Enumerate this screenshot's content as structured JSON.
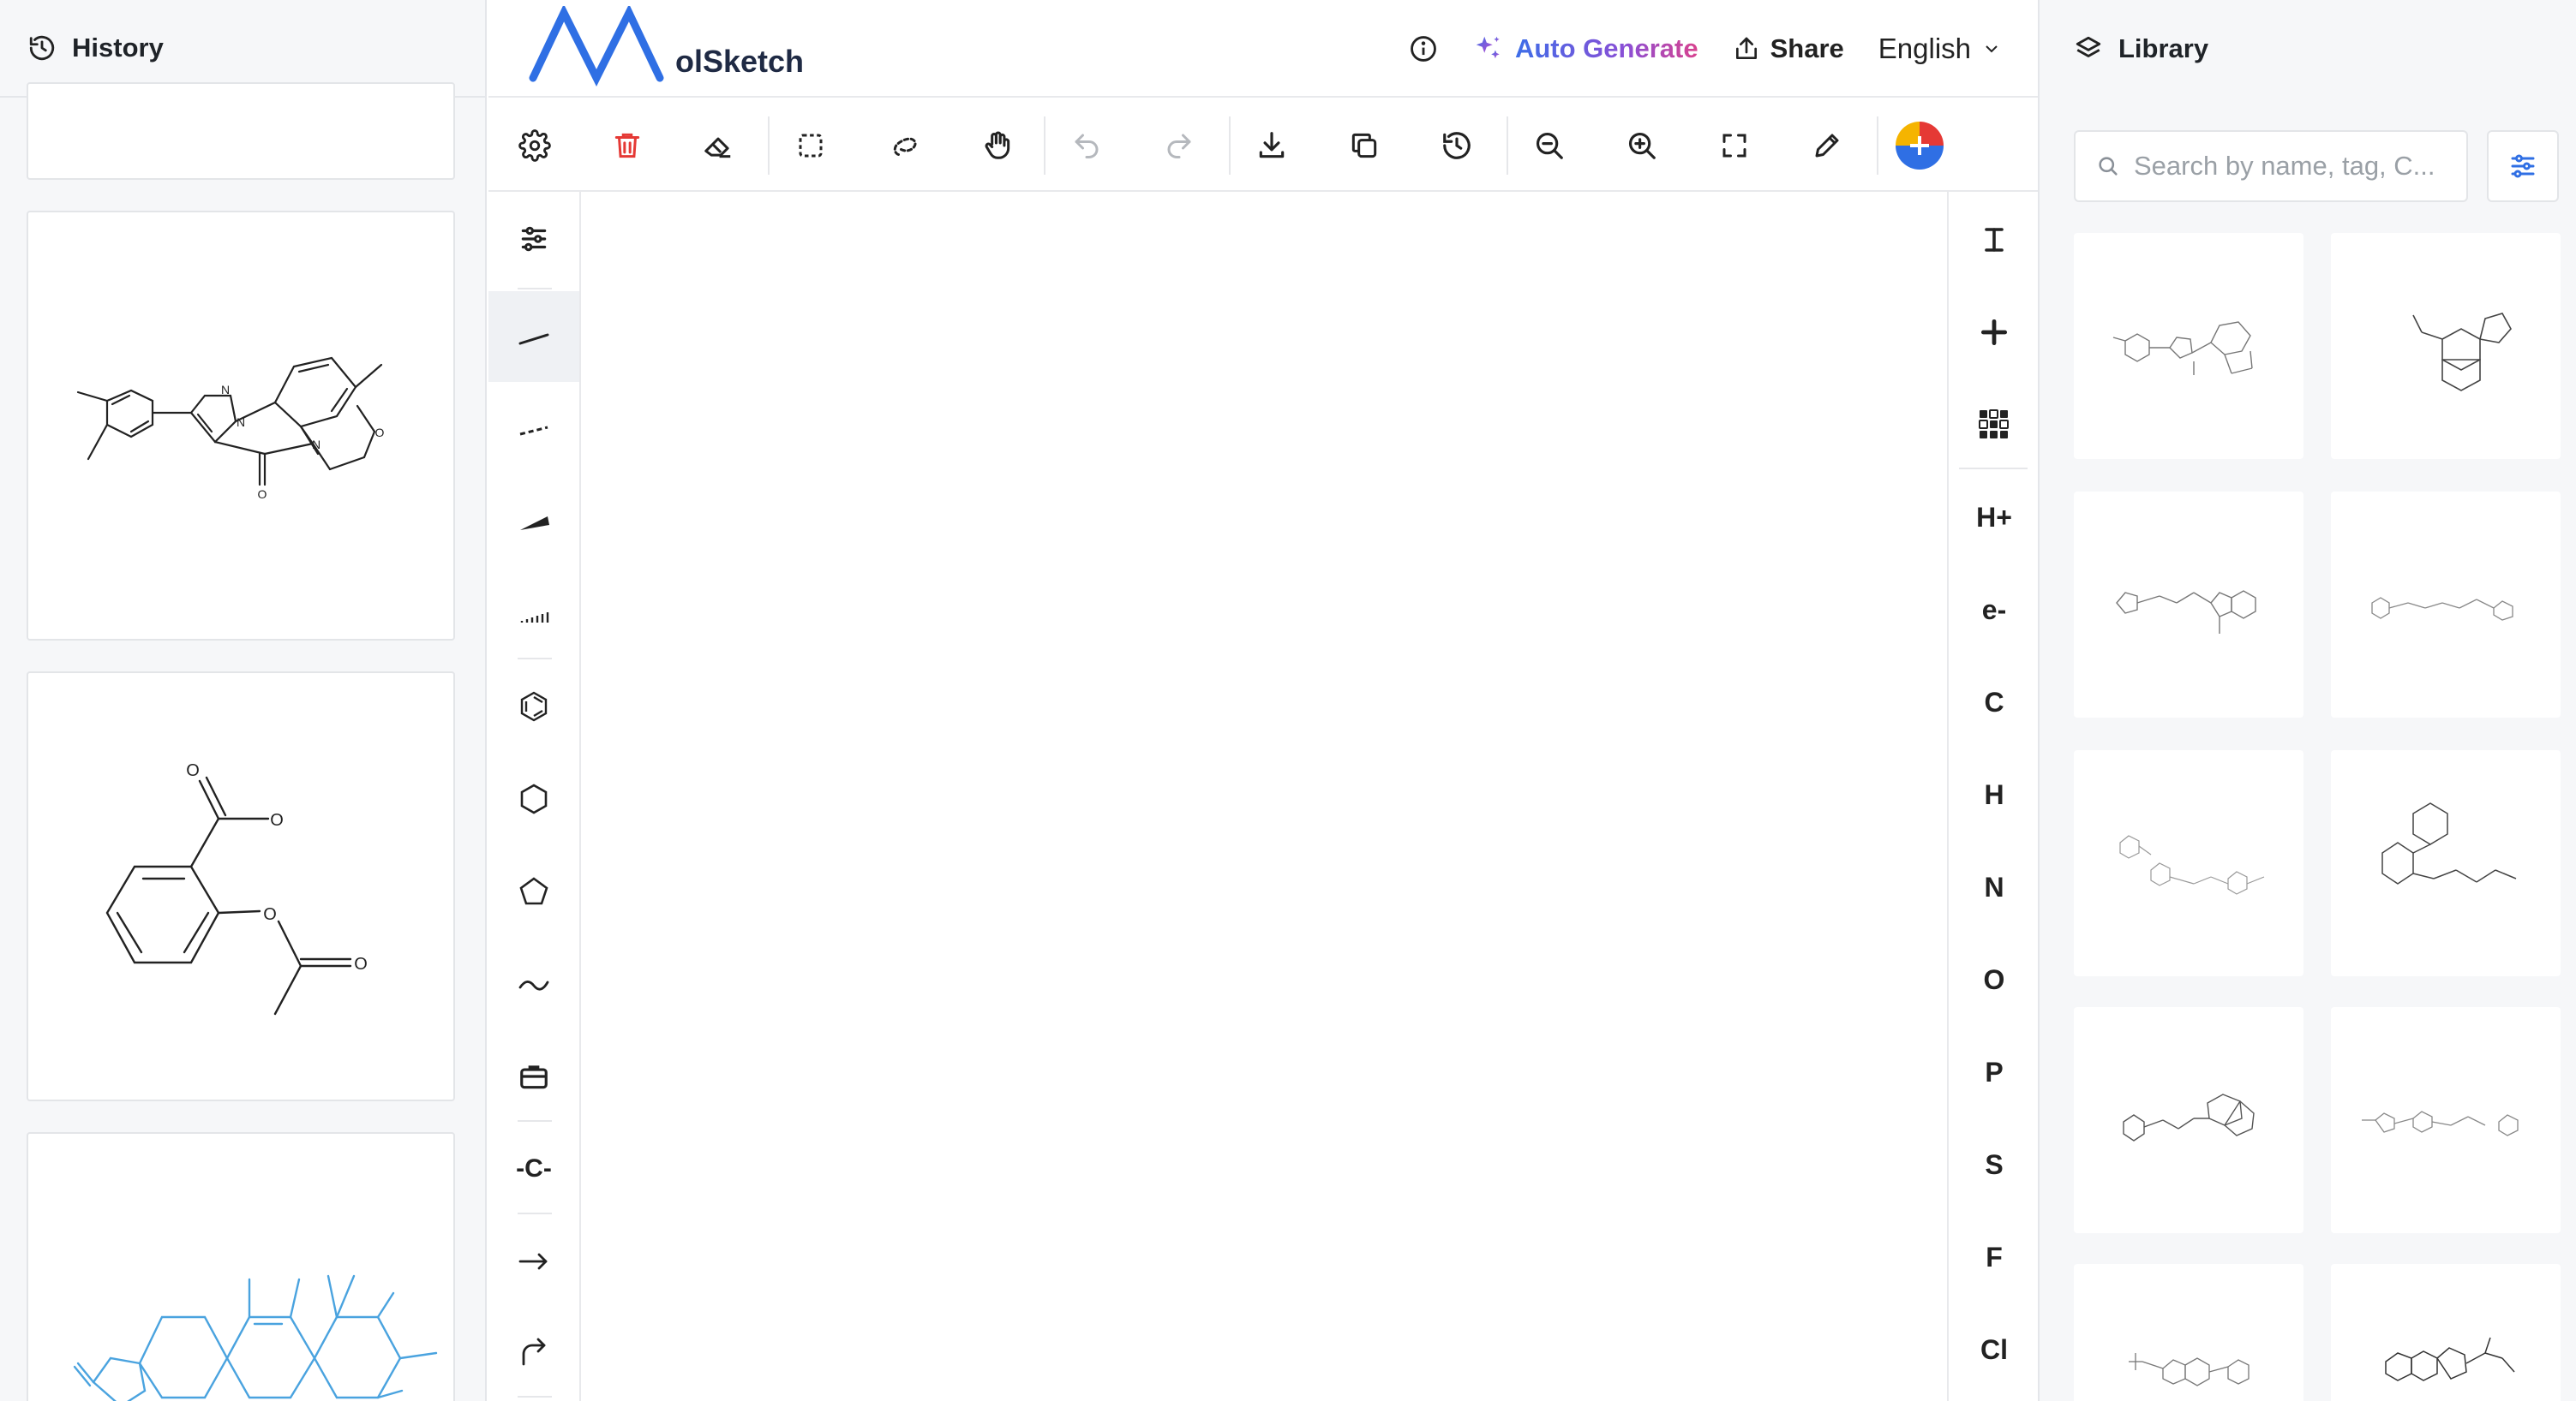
{
  "history": {
    "title": "History"
  },
  "header": {
    "logo_text": "olSketch",
    "auto_generate": "Auto Generate",
    "share": "Share",
    "language": "English"
  },
  "elements": {
    "items": [
      "H+",
      "e-",
      "C",
      "H",
      "N",
      "O",
      "P",
      "S",
      "F",
      "Cl"
    ]
  },
  "left_tools": {
    "chain_label": "-C-"
  },
  "history_molecules": {
    "card1_atoms": [
      "N",
      "N",
      "O",
      "N",
      "O"
    ],
    "card2_atoms": [
      "O",
      "O",
      "O",
      "O"
    ]
  },
  "library": {
    "title": "Library",
    "search_placeholder": "Search by name, tag, C..."
  },
  "colors": {
    "accent_blue": "#2f6fe4",
    "delete_red": "#e53935",
    "history_highlight": "#4aa3df"
  }
}
